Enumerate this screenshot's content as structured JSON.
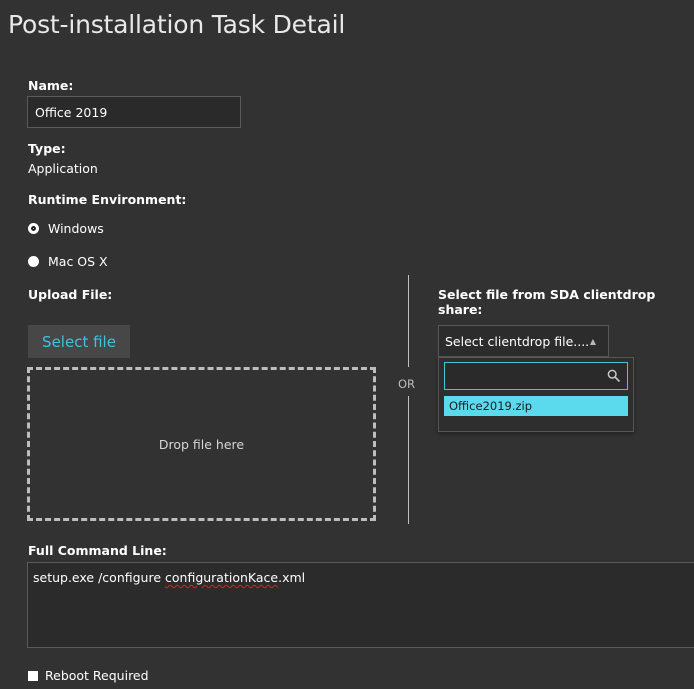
{
  "page": {
    "title": "Post-installation Task Detail"
  },
  "form": {
    "name_label": "Name:",
    "name_value": "Office 2019",
    "type_label": "Type:",
    "type_value": "Application",
    "runtime_label": "Runtime Environment:",
    "runtime_options": [
      {
        "label": "Windows",
        "selected": true
      },
      {
        "label": "Mac OS X",
        "selected": false
      }
    ],
    "upload_label": "Upload File:",
    "select_file_button": "Select file",
    "drop_text": "Drop file here",
    "or_text": "OR",
    "clientdrop_label": "Select file from SDA clientdrop share:",
    "clientdrop_select_value": "Select clientdrop file....",
    "clientdrop_search_value": "",
    "clientdrop_options": [
      "Office2019.zip"
    ],
    "command_label": "Full Command Line:",
    "command_prefix": "setup.exe /configure ",
    "command_misspelled": "configurationKace",
    "command_suffix": ".xml",
    "reboot_label": "Reboot Required",
    "reboot_checked": false
  },
  "colors": {
    "background": "#323232",
    "accent": "#3fc3da",
    "option_highlight": "#5bdaee"
  }
}
